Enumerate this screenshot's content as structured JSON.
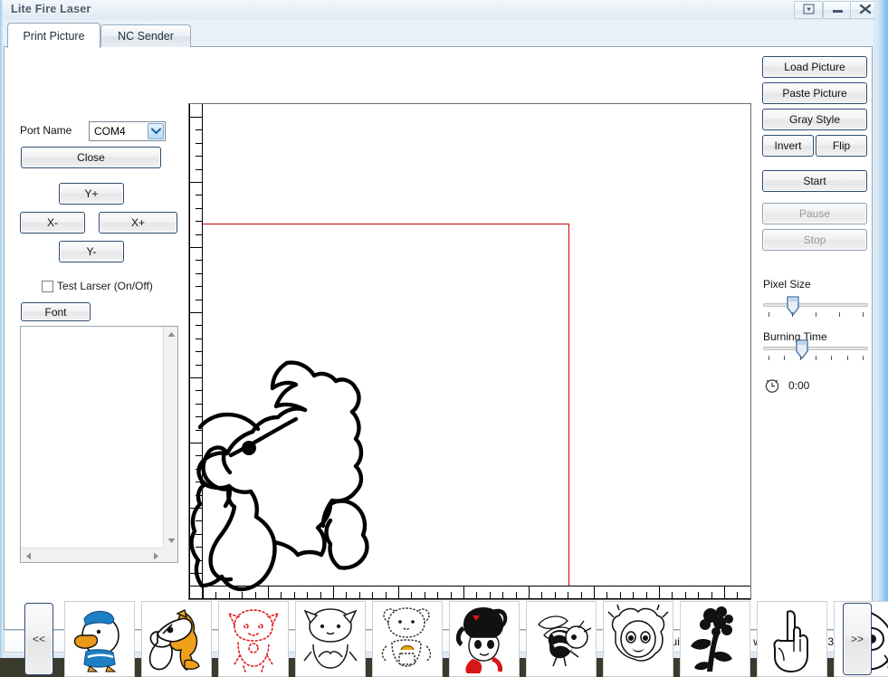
{
  "window": {
    "title": "Lite Fire Laser",
    "controls": [
      {
        "name": "restore-down-button",
        "icon": "caret-down-box-icon"
      },
      {
        "name": "minimize-button",
        "icon": "minimize-icon"
      },
      {
        "name": "close-button",
        "icon": "close-icon"
      }
    ]
  },
  "tabs": [
    {
      "label": "Print Picture",
      "active": true
    },
    {
      "label": "NC Sender",
      "active": false
    }
  ],
  "left_panel": {
    "port_label": "Port Name",
    "port_value": "COM4",
    "port_options": [
      "COM4"
    ],
    "close_button": "Close",
    "jog": {
      "y_plus": "Y+",
      "x_minus": "X-",
      "x_plus": "X+",
      "y_minus": "Y-"
    },
    "test_laser_label": "Test Larser (On/Off)",
    "test_laser_checked": false,
    "font_button": "Font",
    "text_area_value": ""
  },
  "right_panel": {
    "load_picture": "Load Picture",
    "paste_picture": "Paste Picture",
    "gray_style": "Gray Style",
    "invert": "Invert",
    "flip": "Flip",
    "start": "Start",
    "pause": "Pause",
    "stop": "Stop",
    "pause_enabled": false,
    "stop_enabled": false,
    "pixel_size_label": "Pixel Size",
    "pixel_size_ticks": 5,
    "pixel_size_value": 22,
    "burning_time_label": "Burning Time",
    "burning_time_ticks": 7,
    "burning_time_value": 36,
    "timer_icon": "clock-icon",
    "timer_value": "0:00"
  },
  "canvas": {
    "drawing_name": "pony-outline-drawing",
    "boundary_color": "#d40000",
    "ruler_color": "#000000"
  },
  "thumbnails": {
    "prev_label": "<<",
    "next_label": ">>",
    "items": [
      {
        "name": "thumb-duck",
        "title": "duck"
      },
      {
        "name": "thumb-pony",
        "title": "pony"
      },
      {
        "name": "thumb-red-cat",
        "title": "red-outline cat"
      },
      {
        "name": "thumb-white-cat",
        "title": "white cat"
      },
      {
        "name": "thumb-bear-honey",
        "title": "bear with honey"
      },
      {
        "name": "thumb-rabbit-hat",
        "title": "rabbit with hat and red scarf"
      },
      {
        "name": "thumb-bee",
        "title": "bee"
      },
      {
        "name": "thumb-girl-face",
        "title": "girl face"
      },
      {
        "name": "thumb-flower",
        "title": "flower silhouette"
      },
      {
        "name": "thumb-hand-up",
        "title": "hand pointing up"
      },
      {
        "name": "thumb-hand-point",
        "title": "hand pointing forward"
      }
    ]
  },
  "status": {
    "text": "V1.1.4.18 Build Oct 16 2014 work area 38 x 38 mm"
  },
  "colors": {
    "accent": "#2c4a6e",
    "boundary": "#d40000",
    "titlebar_text": "#4a5a6a"
  }
}
